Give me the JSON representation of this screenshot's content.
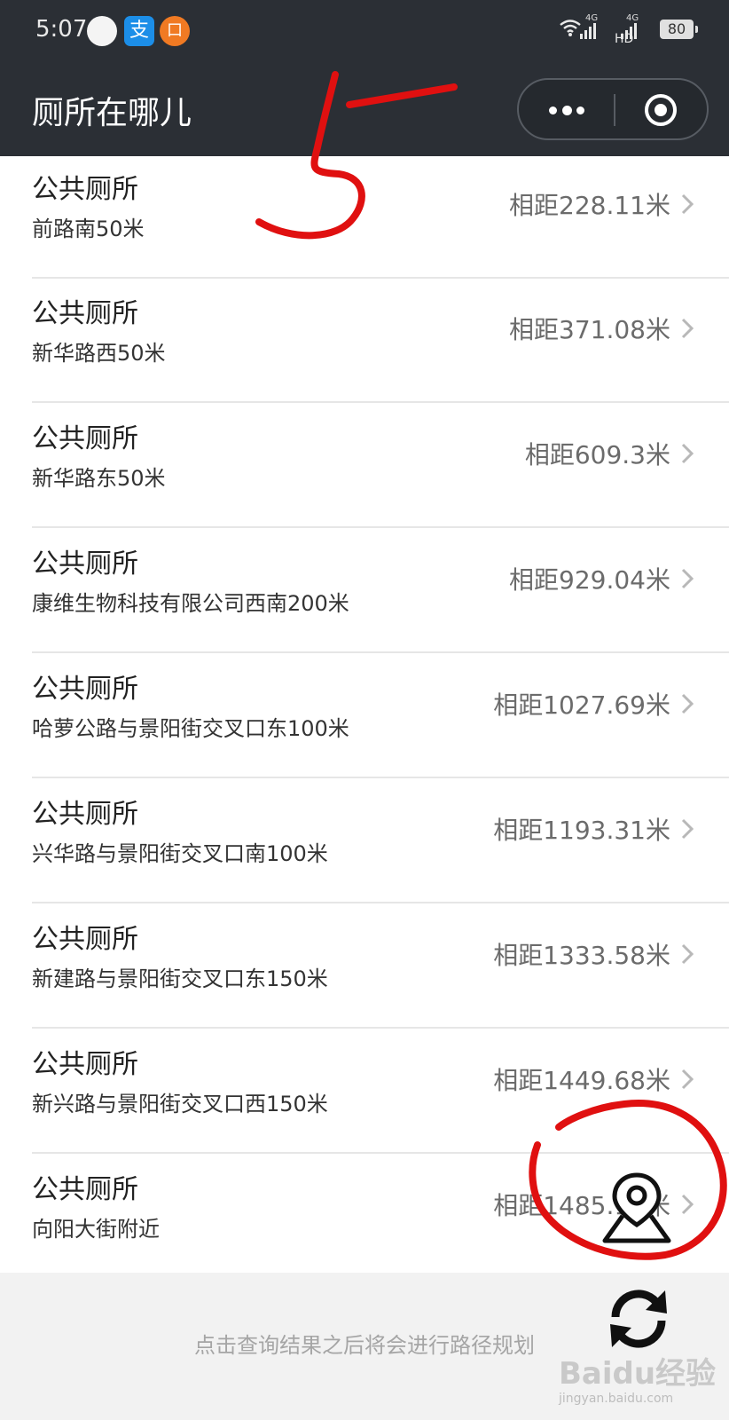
{
  "status_bar": {
    "time": "5:07",
    "network_1": "4G",
    "network_2": "4G",
    "hd": "HD",
    "battery": "80",
    "icons": [
      "notification-dot-icon",
      "alipay-icon",
      "app-badge-icon",
      "wifi-icon",
      "signal-icon",
      "battery-icon"
    ],
    "alipay_glyph": "支",
    "app_glyph": "口"
  },
  "nav": {
    "title": "厕所在哪儿"
  },
  "list": [
    {
      "name": "公共厕所",
      "address": "前路南50米",
      "distance": "相距228.11米"
    },
    {
      "name": "公共厕所",
      "address": "新华路西50米",
      "distance": "相距371.08米"
    },
    {
      "name": "公共厕所",
      "address": "新华路东50米",
      "distance": "相距609.3米"
    },
    {
      "name": "公共厕所",
      "address": "康维生物科技有限公司西南200米",
      "distance": "相距929.04米"
    },
    {
      "name": "公共厕所",
      "address": "哈萝公路与景阳街交叉口东100米",
      "distance": "相距1027.69米"
    },
    {
      "name": "公共厕所",
      "address": "兴华路与景阳街交叉口南100米",
      "distance": "相距1193.31米"
    },
    {
      "name": "公共厕所",
      "address": "新建路与景阳街交叉口东150米",
      "distance": "相距1333.58米"
    },
    {
      "name": "公共厕所",
      "address": "新兴路与景阳街交叉口西150米",
      "distance": "相距1449.68米"
    },
    {
      "name": "公共厕所",
      "address": "向阳大街附近",
      "distance": "相距1485.19米"
    }
  ],
  "footer": {
    "note": "点击查询结果之后将会进行路径规划"
  },
  "watermark": {
    "text": "Baidu经验",
    "url": "jingyan.baidu.com"
  },
  "annotation": {
    "number": "5",
    "color": "#e01010"
  },
  "colors": {
    "nav_bg": "#2b2f35",
    "list_bg": "#ffffff",
    "page_bg": "#f2f2f2"
  }
}
